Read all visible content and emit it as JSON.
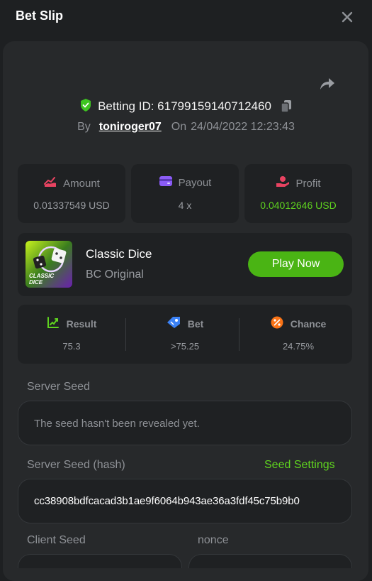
{
  "header": {
    "title": "Bet Slip"
  },
  "bet": {
    "id_label": "Betting ID: 61799159140712460",
    "by": "By",
    "username": "toniroger07",
    "on": "On",
    "datetime": "24/04/2022 12:23:43"
  },
  "stats": [
    {
      "label": "Amount",
      "value": "0.01337549 USD",
      "icon": "amount-icon",
      "color": "#e84361"
    },
    {
      "label": "Payout",
      "value": "4 x",
      "icon": "payout-card-icon",
      "color": "#8b5cf6"
    },
    {
      "label": "Profit",
      "value": "0.04012646 USD",
      "icon": "profit-hand-icon",
      "color": "#e84361"
    }
  ],
  "game": {
    "name": "Classic Dice",
    "subtitle": "BC Original",
    "play_label": "Play Now",
    "thumb_text_1": "CLASSIC",
    "thumb_text_2": "DICE"
  },
  "result": [
    {
      "label": "Result",
      "value": "75.3",
      "icon": "result-chart-icon",
      "color": "#5fd31f"
    },
    {
      "label": "Bet",
      "value": ">75.25",
      "icon": "bet-tag-icon",
      "color": "#3b82f6"
    },
    {
      "label": "Chance",
      "value": "24.75%",
      "icon": "percent-icon",
      "color": "#f97316"
    }
  ],
  "seeds": {
    "server_seed_label": "Server Seed",
    "server_seed_value": "The seed hasn't been revealed yet.",
    "server_hash_label": "Server Seed (hash)",
    "seed_settings_label": "Seed Settings",
    "server_hash_value": "cc38908bdfcacad3b1ae9f6064b943ae36a3fdf45c75b9b0",
    "client_seed_label": "Client Seed",
    "nonce_label": "nonce"
  },
  "colors": {
    "accent_green": "#5fd31f",
    "button_green": "#4ab414",
    "background": "#1e2022",
    "panel": "#27292b",
    "card": "#1f2123"
  }
}
